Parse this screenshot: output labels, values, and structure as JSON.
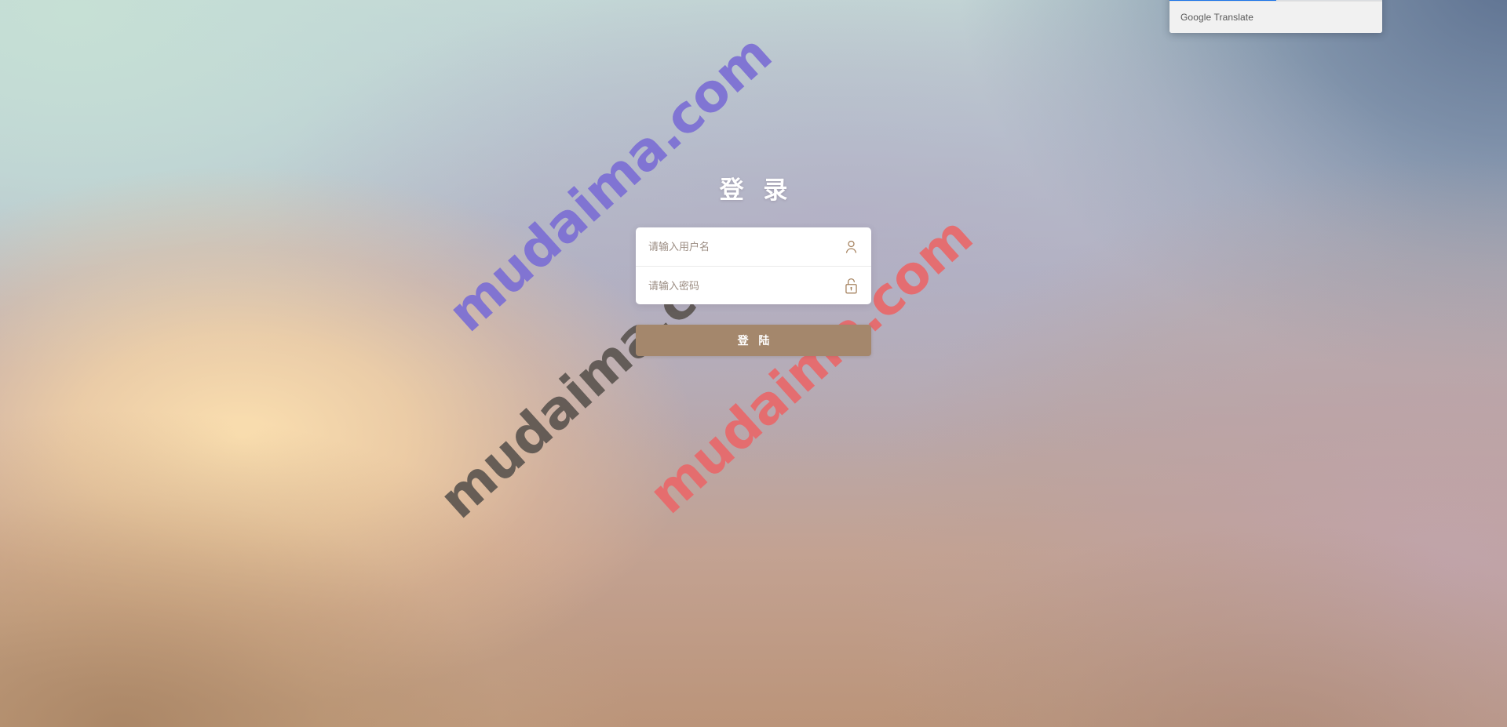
{
  "page": {
    "title": "登录",
    "background_colors": {
      "top_left_mint": "#c6e0d5",
      "top_right_slate": "#566a8c",
      "mid_lilac": "#b2a8c2",
      "peach_glow": "#fde1b0",
      "bottom_left_tan": "#a98564",
      "bottom_right_mauve": "#c0a4ac"
    }
  },
  "login": {
    "heading": "登 录",
    "fields": [
      {
        "name": "username",
        "placeholder": "请输入用户名",
        "value": "",
        "icon": "user-icon",
        "icon_color": "#a4805c"
      },
      {
        "name": "password",
        "placeholder": "请输入密码",
        "value": "",
        "icon": "unlocked-padlock-icon",
        "icon_color": "#a4805c"
      }
    ],
    "submit_label": "登 陆",
    "submit_color": "#a4876c",
    "card_background": "#ffffff"
  },
  "watermarks": [
    {
      "text": "mudaima.com",
      "color": "#7c6fd4"
    },
    {
      "text": "mudaima.com",
      "color": "#57514c"
    },
    {
      "text": "mudaima.com",
      "color": "#e8696b"
    }
  ],
  "translate_popup": {
    "tabs": [
      {
        "label": "",
        "active": true
      },
      {
        "label": "",
        "active": false
      }
    ],
    "brand": "Google Translate",
    "accent_color": "#1a73e8",
    "footer_background": "#f1f1f1"
  }
}
